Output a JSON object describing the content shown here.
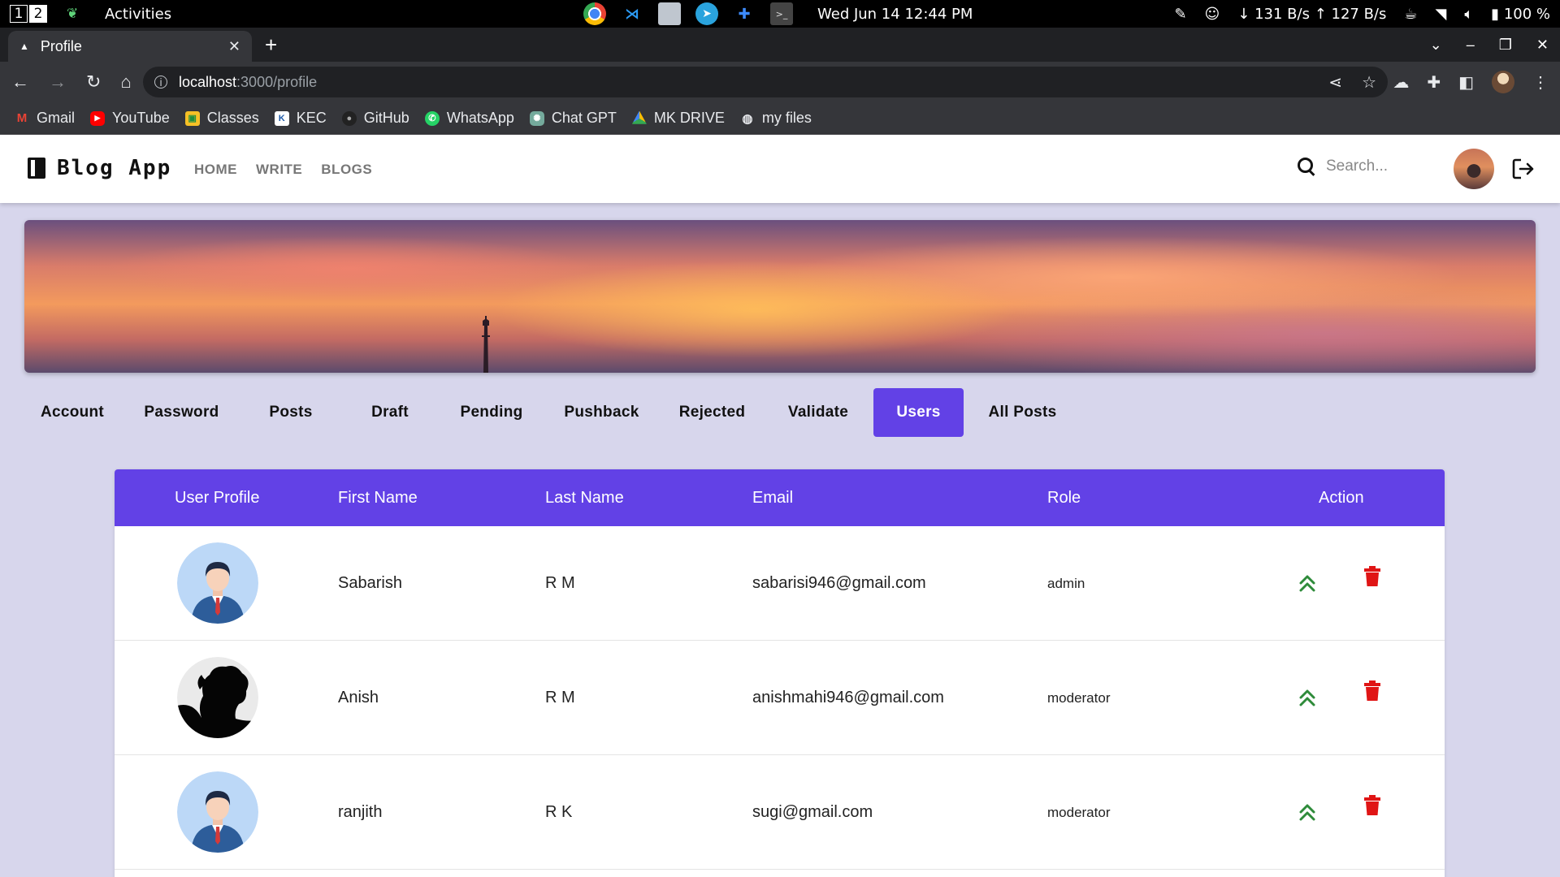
{
  "os": {
    "workspaces": [
      "1",
      "2"
    ],
    "activities": "Activities",
    "clock": "Wed Jun 14  12:44 PM",
    "network_speed": "↓ 131 B/s ↑ 127 B/s",
    "battery": "100 %"
  },
  "browser": {
    "tab_title": "Profile",
    "url_host": "localhost",
    "url_path": ":3000/profile",
    "bookmarks": [
      "Gmail",
      "YouTube",
      "Classes",
      "KEC",
      "GitHub",
      "WhatsApp",
      "Chat GPT",
      "MK DRIVE",
      "my files"
    ]
  },
  "app": {
    "brand": "Blog App",
    "nav": [
      "HOME",
      "WRITE",
      "BLOGS"
    ],
    "search_placeholder": "Search..."
  },
  "profile_tabs": {
    "items": [
      "Account",
      "Password",
      "Posts",
      "Draft",
      "Pending",
      "Pushback",
      "Rejected",
      "Validate",
      "Users",
      "All Posts"
    ],
    "active": "Users"
  },
  "users_table": {
    "headers": [
      "User Profile",
      "First Name",
      "Last Name",
      "Email",
      "Role",
      "Action"
    ],
    "rows": [
      {
        "first_name": "Sabarish",
        "last_name": "R M",
        "email": "sabarisi946@gmail.com",
        "role": "admin",
        "avatar": "cartoon-man-avatar"
      },
      {
        "first_name": "Anish",
        "last_name": "R M",
        "email": "anishmahi946@gmail.com",
        "role": "moderator",
        "avatar": "silhouette-photo-avatar"
      },
      {
        "first_name": "ranjith",
        "last_name": "R K",
        "email": "sugi@gmail.com",
        "role": "moderator",
        "avatar": "cartoon-man-avatar"
      }
    ]
  },
  "colors": {
    "accent": "#6241e6",
    "page_bg": "#d7d6ec",
    "promote": "#2e8b3a",
    "delete": "#e01515"
  }
}
